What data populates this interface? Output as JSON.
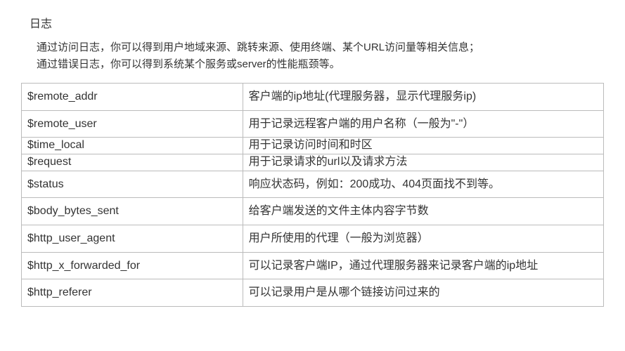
{
  "title": "日志",
  "description_line1": "通过访问日志，你可以得到用户地域来源、跳转来源、使用终端、某个URL访问量等相关信息；",
  "description_line2": "通过错误日志，你可以得到系统某个服务或server的性能瓶颈等。",
  "table": {
    "rows": [
      {
        "variable": "$remote_addr",
        "desc": "客户端的ip地址(代理服务器，显示代理服务ip)",
        "tight": false
      },
      {
        "variable": "$remote_user",
        "desc": "用于记录远程客户端的用户名称（一般为\"-\"）",
        "tight": false
      },
      {
        "variable": "$time_local",
        "desc": "用于记录访问时间和时区",
        "tight": true
      },
      {
        "variable": "$request",
        "desc": "用于记录请求的url以及请求方法",
        "tight": true
      },
      {
        "variable": "$status",
        "desc": "响应状态码，例如：200成功、404页面找不到等。",
        "tight": false
      },
      {
        "variable": "$body_bytes_sent",
        "desc": "给客户端发送的文件主体内容字节数",
        "tight": false
      },
      {
        "variable": "$http_user_agent",
        "desc": "用户所使用的代理（一般为浏览器）",
        "tight": false
      },
      {
        "variable": "$http_x_forwarded_for",
        "desc": "可以记录客户端IP，通过代理服务器来记录客户端的ip地址",
        "tight": false
      },
      {
        "variable": "$http_referer",
        "desc": "可以记录用户是从哪个链接访问过来的",
        "tight": false
      }
    ]
  }
}
